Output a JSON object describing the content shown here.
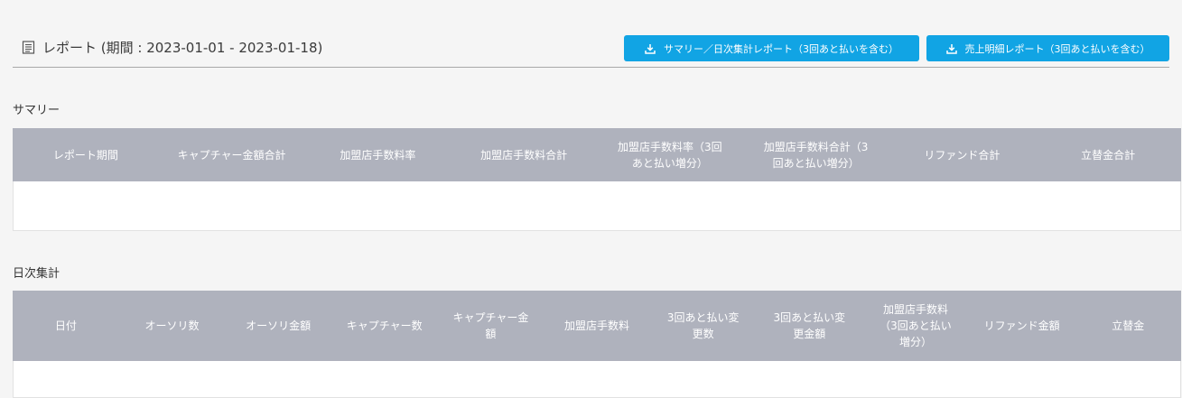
{
  "header": {
    "title": "レポート (期間 : 2023-01-01 - 2023-01-18)",
    "buttons": {
      "summary_report": "サマリー／日次集計レポート（3回あと払いを含む）",
      "sales_detail_report": "売上明細レポート（3回あと払いを含む）"
    }
  },
  "summary": {
    "label": "サマリー",
    "columns": [
      "レポート期間",
      "キャプチャー金額合計",
      "加盟店手数料率",
      "加盟店手数料合計",
      "加盟店手数料率（3回あと払い増分）",
      "加盟店手数料合計（3回あと払い増分）",
      "リファンド合計",
      "立替金合計"
    ],
    "rows": []
  },
  "daily": {
    "label": "日次集計",
    "columns": [
      "日付",
      "オーソリ数",
      "オーソリ金額",
      "キャプチャー数",
      "キャプチャー金額",
      "加盟店手数料",
      "3回あと払い変更数",
      "3回あと払い変更金額",
      "加盟店手数料（3回あと払い増分）",
      "リファンド金額",
      "立替金"
    ],
    "rows": []
  },
  "colors": {
    "accent": "#11a4e4",
    "table_header": "#afb2bd",
    "background": "#f5f5f5"
  }
}
